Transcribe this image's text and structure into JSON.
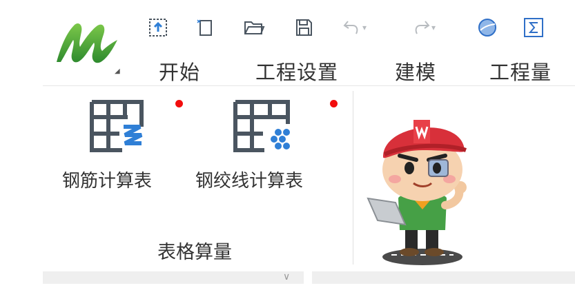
{
  "app": {
    "logo_icon": "glodon-m-logo-icon",
    "logo_caret": "◢"
  },
  "quick_access": {
    "icons": [
      "import-icon",
      "new-file-icon",
      "open-folder-icon",
      "save-icon",
      "undo-icon",
      "redo-icon",
      "globe-icon",
      "sum-icon"
    ],
    "dropdown_glyph": "▾"
  },
  "tabs": [
    {
      "label": "开始"
    },
    {
      "label": "工程设置"
    },
    {
      "label": "建模"
    },
    {
      "label": "工程量"
    }
  ],
  "ribbon": {
    "tools": [
      {
        "label": "钢筋计算表",
        "icon": "rebar-table-icon",
        "has_notification": true
      },
      {
        "label": "钢绞线计算表",
        "icon": "strand-table-icon",
        "has_notification": true
      }
    ],
    "group_label": "表格算量"
  },
  "bottom": {
    "dropdown_caret": "∨"
  },
  "colors": {
    "accent_blue": "#2f7fd6",
    "icon_gray": "#4a5560",
    "notification_red": "#f20d0d",
    "logo_green": "#4cae3c"
  }
}
